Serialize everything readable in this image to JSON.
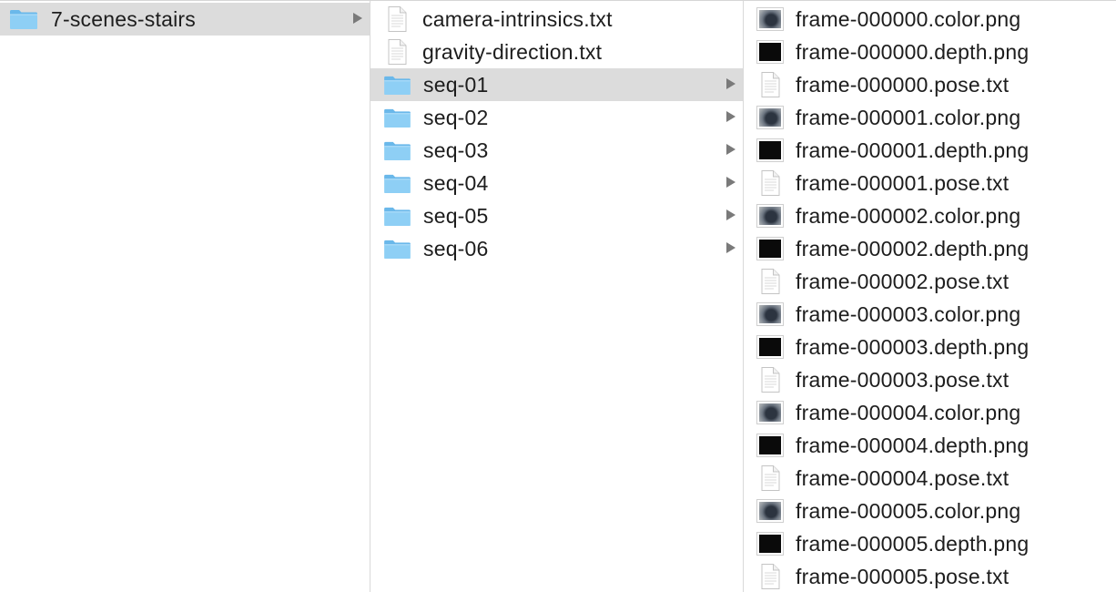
{
  "columns": [
    {
      "items": [
        {
          "label": "7-scenes-stairs",
          "kind": "folder",
          "selected": true,
          "has_children": true
        }
      ]
    },
    {
      "items": [
        {
          "label": "camera-intrinsics.txt",
          "kind": "text"
        },
        {
          "label": "gravity-direction.txt",
          "kind": "text"
        },
        {
          "label": "seq-01",
          "kind": "folder",
          "selected": true,
          "has_children": true
        },
        {
          "label": "seq-02",
          "kind": "folder",
          "has_children": true
        },
        {
          "label": "seq-03",
          "kind": "folder",
          "has_children": true
        },
        {
          "label": "seq-04",
          "kind": "folder",
          "has_children": true
        },
        {
          "label": "seq-05",
          "kind": "folder",
          "has_children": true
        },
        {
          "label": "seq-06",
          "kind": "folder",
          "has_children": true
        }
      ]
    },
    {
      "items": [
        {
          "label": "frame-000000.color.png",
          "kind": "color-image"
        },
        {
          "label": "frame-000000.depth.png",
          "kind": "depth-image"
        },
        {
          "label": "frame-000000.pose.txt",
          "kind": "text"
        },
        {
          "label": "frame-000001.color.png",
          "kind": "color-image"
        },
        {
          "label": "frame-000001.depth.png",
          "kind": "depth-image"
        },
        {
          "label": "frame-000001.pose.txt",
          "kind": "text"
        },
        {
          "label": "frame-000002.color.png",
          "kind": "color-image"
        },
        {
          "label": "frame-000002.depth.png",
          "kind": "depth-image"
        },
        {
          "label": "frame-000002.pose.txt",
          "kind": "text"
        },
        {
          "label": "frame-000003.color.png",
          "kind": "color-image"
        },
        {
          "label": "frame-000003.depth.png",
          "kind": "depth-image"
        },
        {
          "label": "frame-000003.pose.txt",
          "kind": "text"
        },
        {
          "label": "frame-000004.color.png",
          "kind": "color-image"
        },
        {
          "label": "frame-000004.depth.png",
          "kind": "depth-image"
        },
        {
          "label": "frame-000004.pose.txt",
          "kind": "text"
        },
        {
          "label": "frame-000005.color.png",
          "kind": "color-image"
        },
        {
          "label": "frame-000005.depth.png",
          "kind": "depth-image"
        },
        {
          "label": "frame-000005.pose.txt",
          "kind": "text"
        }
      ]
    }
  ],
  "icons": {
    "folder": "folder-icon",
    "text": "text-file-icon",
    "color-image": "color-image-thumbnail-icon",
    "depth-image": "depth-image-thumbnail-icon",
    "expand": "chevron-right-icon"
  },
  "colors": {
    "selection": "#dcdcdc",
    "folder_body": "#8ecff5",
    "folder_tab": "#6ab8ea",
    "chevron": "#7a7a7a"
  }
}
